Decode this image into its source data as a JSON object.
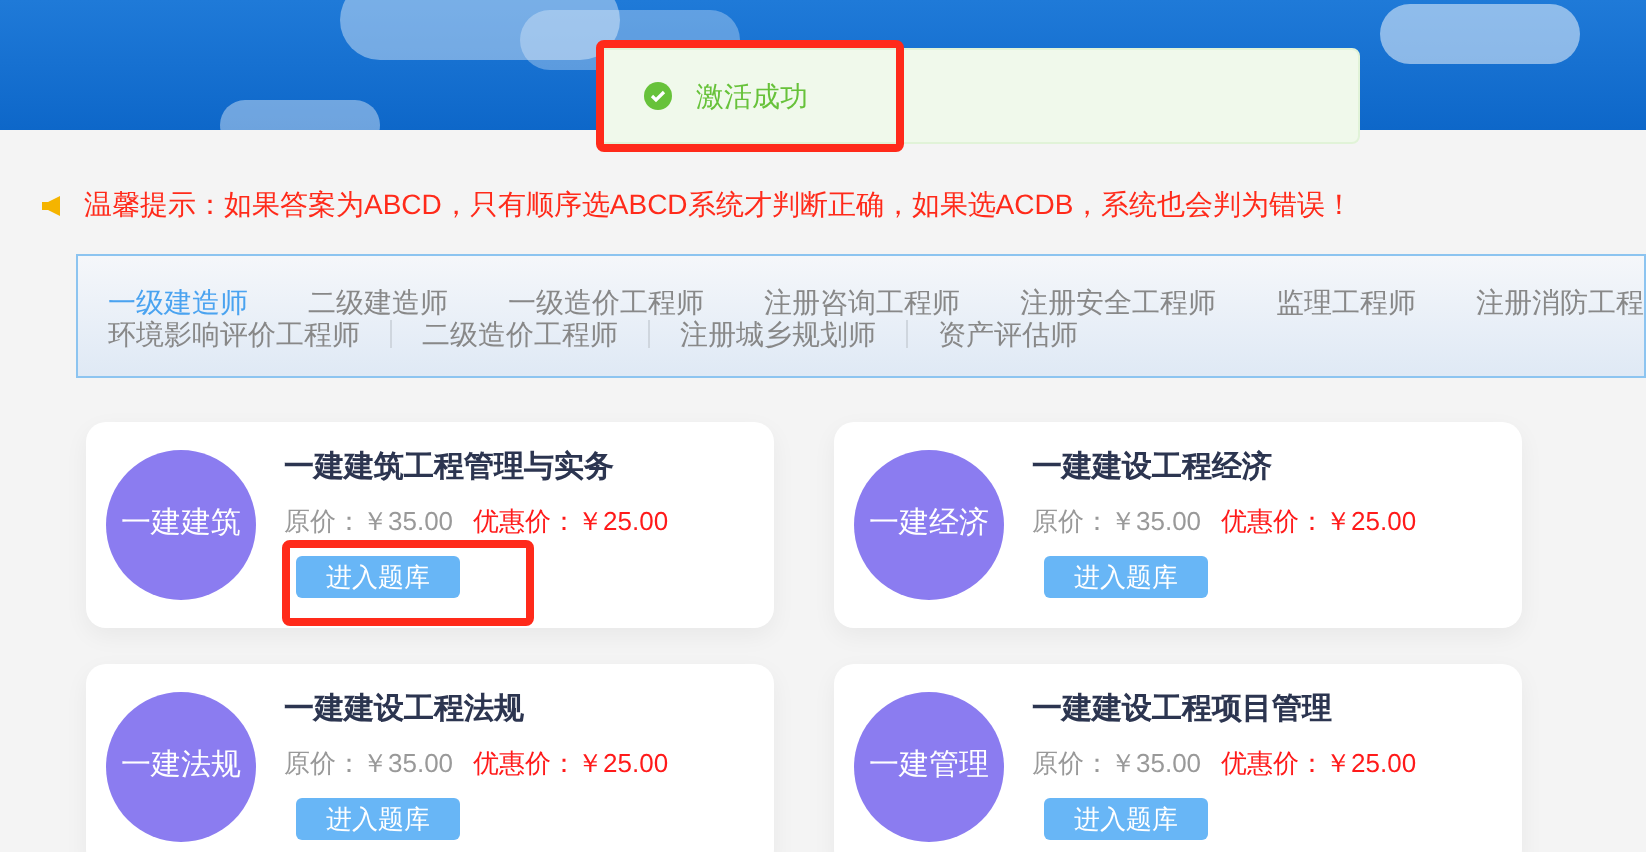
{
  "toast": {
    "kind": "success",
    "message": "激活成功"
  },
  "notice": "温馨提示：如果答案为ABCD，只有顺序选ABCD系统才判断正确，如果选ACDB，系统也会判为错误！",
  "categories": [
    [
      {
        "label": "一级建造师",
        "selected": true
      },
      {
        "label": "二级建造师",
        "selected": false
      },
      {
        "label": "一级造价工程师",
        "selected": false
      },
      {
        "label": "注册咨询工程师",
        "selected": false
      },
      {
        "label": "注册安全工程师",
        "selected": false
      },
      {
        "label": "监理工程师",
        "selected": false
      },
      {
        "label": "注册消防工程",
        "selected": false
      }
    ],
    [
      {
        "label": "环境影响评价工程师",
        "selected": false
      },
      {
        "label": "二级造价工程师",
        "selected": false
      },
      {
        "label": "注册城乡规划师",
        "selected": false
      },
      {
        "label": "资产评估师",
        "selected": false
      }
    ]
  ],
  "courses": [
    {
      "badge": "一建建筑",
      "title": "一建建筑工程管理与实务",
      "original_price": "原价：￥35.00",
      "sale_price": "优惠价：￥25.00",
      "button": "进入题库",
      "highlighted": true
    },
    {
      "badge": "一建经济",
      "title": "一建建设工程经济",
      "original_price": "原价：￥35.00",
      "sale_price": "优惠价：￥25.00",
      "button": "进入题库",
      "highlighted": false
    },
    {
      "badge": "一建法规",
      "title": "一建建设工程法规",
      "original_price": "原价：￥35.00",
      "sale_price": "优惠价：￥25.00",
      "button": "进入题库",
      "highlighted": false
    },
    {
      "badge": "一建管理",
      "title": "一建建设工程项目管理",
      "original_price": "原价：￥35.00",
      "sale_price": "优惠价：￥25.00",
      "button": "进入题库",
      "highlighted": false
    }
  ]
}
